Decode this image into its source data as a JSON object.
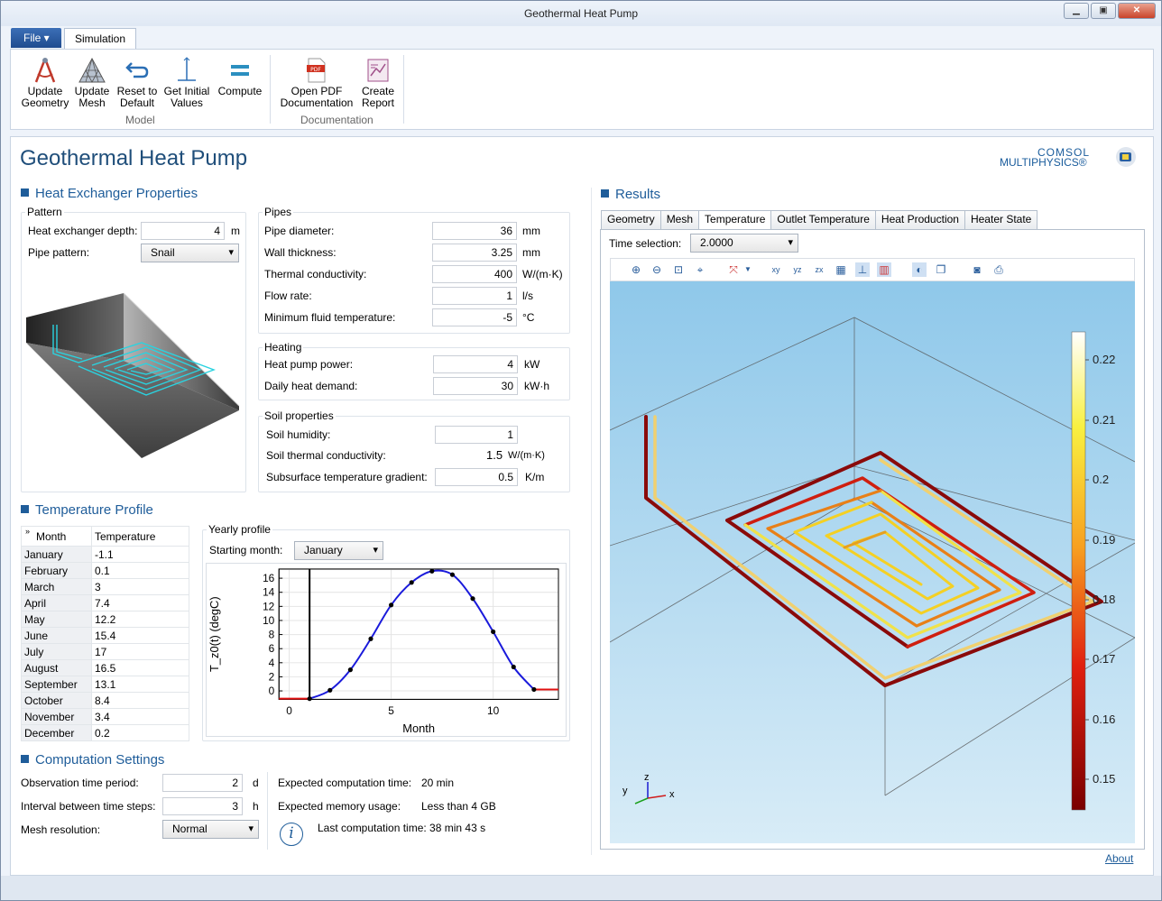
{
  "window": {
    "title": "Geothermal Heat Pump",
    "buttons": [
      "▁",
      "▣",
      "✕"
    ]
  },
  "menu": {
    "file_label": "File ▾",
    "tab": "Simulation"
  },
  "ribbon": {
    "buttons": [
      {
        "label1": "Update",
        "label2": "Geometry"
      },
      {
        "label1": "Update",
        "label2": "Mesh"
      },
      {
        "label1": "Reset to",
        "label2": "Default"
      },
      {
        "label1": "Get Initial",
        "label2": "Values"
      },
      {
        "label1": "Compute",
        "label2": ""
      },
      {
        "label1": "Open PDF",
        "label2": "Documentation"
      },
      {
        "label1": "Create",
        "label2": "Report"
      }
    ],
    "groups": [
      "Model",
      "Documentation"
    ]
  },
  "app": {
    "title": "Geothermal Heat Pump",
    "logo1": "COMSOL",
    "logo2": "MULTIPHYSICS®"
  },
  "heat_exchanger": {
    "section": "Heat Exchanger Properties",
    "pattern": {
      "legend": "Pattern",
      "depth_label": "Heat exchanger depth:",
      "depth_value": "4",
      "depth_unit": "m",
      "pipe_pattern_label": "Pipe pattern:",
      "pipe_pattern_value": "Snail"
    },
    "pipes": {
      "legend": "Pipes",
      "rows": [
        {
          "label": "Pipe diameter:",
          "value": "36",
          "unit": "mm"
        },
        {
          "label": "Wall thickness:",
          "value": "3.25",
          "unit": "mm"
        },
        {
          "label": "Thermal conductivity:",
          "value": "400",
          "unit": "W/(m·K)"
        },
        {
          "label": "Flow rate:",
          "value": "1",
          "unit": "l/s"
        },
        {
          "label": "Minimum fluid temperature:",
          "value": "-5",
          "unit": "°C"
        }
      ]
    },
    "heating": {
      "legend": "Heating",
      "rows": [
        {
          "label": "Heat pump power:",
          "value": "4",
          "unit": "kW"
        },
        {
          "label": "Daily heat demand:",
          "value": "30",
          "unit": "kW·h"
        }
      ]
    },
    "soil": {
      "legend": "Soil properties",
      "humidity_label": "Soil humidity:",
      "humidity_value": "1",
      "conductivity_label": "Soil thermal conductivity:",
      "conductivity_value": "1.5",
      "conductivity_unit": "W/(m·K)",
      "gradient_label": "Subsurface temperature gradient:",
      "gradient_value": "0.5",
      "gradient_unit": "K/m"
    }
  },
  "temperature_profile": {
    "section": "Temperature Profile",
    "columns": [
      "Month",
      "Temperature"
    ],
    "rows": [
      [
        "January",
        "-1.1"
      ],
      [
        "February",
        "0.1"
      ],
      [
        "March",
        "3"
      ],
      [
        "April",
        "7.4"
      ],
      [
        "May",
        "12.2"
      ],
      [
        "June",
        "15.4"
      ],
      [
        "July",
        "17"
      ],
      [
        "August",
        "16.5"
      ],
      [
        "September",
        "13.1"
      ],
      [
        "October",
        "8.4"
      ],
      [
        "November",
        "3.4"
      ],
      [
        "December",
        "0.2"
      ]
    ],
    "yearly_legend": "Yearly profile",
    "starting_month_label": "Starting month:",
    "starting_month_value": "January"
  },
  "chart_data": {
    "type": "line",
    "x": [
      1,
      2,
      3,
      4,
      5,
      6,
      7,
      8,
      9,
      10,
      11,
      12
    ],
    "series": [
      {
        "values": [
          -1.1,
          0.1,
          3,
          7.4,
          12.2,
          15.4,
          17,
          16.5,
          13.1,
          8.4,
          3.4,
          0.2
        ]
      }
    ],
    "xlabel": "Month",
    "ylabel": "T_z0(t) (degC)",
    "xticks": [
      0,
      5,
      10
    ],
    "yticks": [
      0,
      2,
      4,
      6,
      8,
      10,
      12,
      14,
      16
    ],
    "xlim": [
      -0.5,
      13.2
    ],
    "ylim": [
      -1.2,
      17.3
    ],
    "grid": true,
    "colors": {
      "line": "#1a1adb",
      "marker": "#000000",
      "extrap": "#e01010"
    }
  },
  "computation": {
    "section": "Computation Settings",
    "obs_label": "Observation time period:",
    "obs_value": "2",
    "obs_unit": "d",
    "interval_label": "Interval between time steps:",
    "interval_value": "3",
    "interval_unit": "h",
    "mesh_label": "Mesh resolution:",
    "mesh_value": "Normal",
    "exp_time_label": "Expected computation time:",
    "exp_time_value": "20 min",
    "exp_mem_label": "Expected memory usage:",
    "exp_mem_value": "Less than 4 GB",
    "last_label": "Last computation time: 38 min 43 s",
    "info_icon": "i"
  },
  "results": {
    "section": "Results",
    "tabs": [
      "Geometry",
      "Mesh",
      "Temperature",
      "Outlet Temperature",
      "Heat Production",
      "Heater State"
    ],
    "active_tab": "Temperature",
    "time_label": "Time selection:",
    "time_value": "2.0000",
    "colorbar_ticks": [
      "0.22",
      "0.21",
      "0.2",
      "0.19",
      "0.18",
      "0.17",
      "0.16",
      "0.15"
    ],
    "axes": {
      "x": "x",
      "y": "y",
      "z": "z"
    }
  },
  "about": "About"
}
